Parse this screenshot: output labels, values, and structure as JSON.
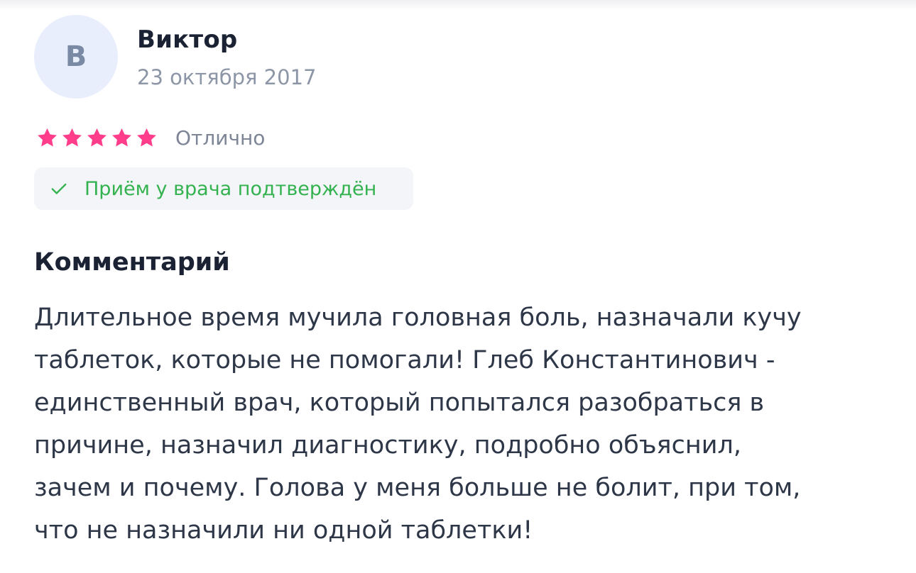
{
  "review": {
    "avatar_letter": "В",
    "author": "Виктор",
    "date": "23 октября 2017",
    "rating": {
      "stars": 5,
      "max_stars": 5,
      "label": "Отлично",
      "star_color": "#ff3d8a"
    },
    "confirmation": {
      "icon": "check-icon",
      "text": "Приём у врача подтверждён",
      "color": "#33b24f"
    },
    "comment": {
      "heading": "Комментарий",
      "lines": [
        "Длительное время мучила головная боль, назначали кучу",
        "таблеток, которые не помогали! Глеб Константинович -",
        "единственный врач, который попытался разобраться в",
        "причине, назначил диагностику, подробно объяснил,",
        "зачем и почему. Голова у меня больше не болит, при том,",
        "что не назначили ни одной таблетки!"
      ]
    }
  }
}
